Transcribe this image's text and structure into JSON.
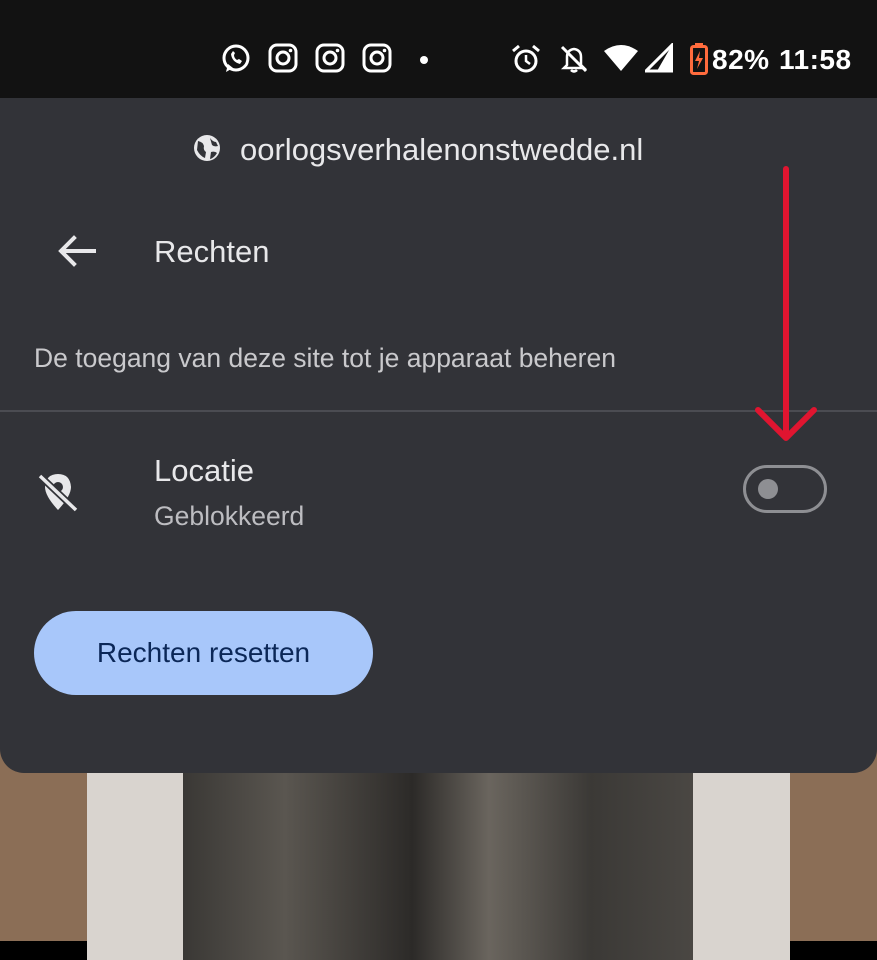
{
  "status_bar": {
    "battery": "82%",
    "time": "11:58",
    "app_icons": [
      "whatsapp-icon",
      "instagram-icon",
      "instagram-icon",
      "instagram-icon",
      "dot-icon"
    ],
    "system_icons": [
      "alarm-icon",
      "bell-off-icon",
      "wifi-icon",
      "signal-icon",
      "battery-icon"
    ]
  },
  "sheet": {
    "site": "oorlogsverhalenonstwedde.nl",
    "title": "Rechten",
    "description": "De toegang van deze site tot je apparaat beheren",
    "permission": {
      "label": "Locatie",
      "status": "Geblokkeerd",
      "enabled": false
    },
    "reset_label": "Rechten resetten"
  },
  "colors": {
    "sheet_bg": "#323338",
    "button_bg": "#a8c7fa",
    "button_text": "#0b2757",
    "arrow": "#e01530"
  }
}
